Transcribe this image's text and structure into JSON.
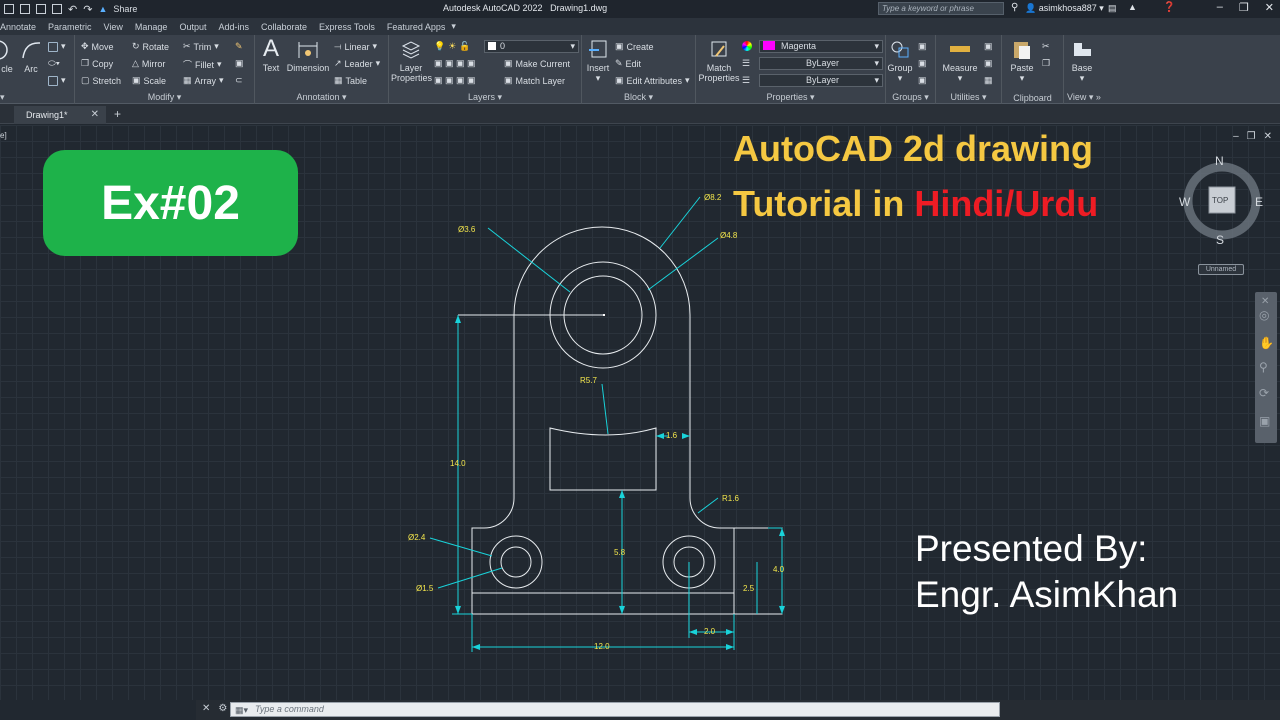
{
  "titlebar": {
    "share_label": "Share",
    "app_title": "Autodesk AutoCAD 2022",
    "file_name": "Drawing1.dwg",
    "search_placeholder": "Type a keyword or phrase",
    "username": "asimkhosa887"
  },
  "menu_tabs": [
    "Annotate",
    "Parametric",
    "View",
    "Manage",
    "Output",
    "Add-ins",
    "Collaborate",
    "Express Tools",
    "Featured Apps"
  ],
  "ribbon": {
    "draw": {
      "circle_label": "cle",
      "arc_label": "Arc"
    },
    "modify": {
      "label": "Modify",
      "move": "Move",
      "rotate": "Rotate",
      "trim": "Trim",
      "copy": "Copy",
      "mirror": "Mirror",
      "fillet": "Fillet",
      "stretch": "Stretch",
      "scale": "Scale",
      "array": "Array"
    },
    "annotation": {
      "label": "Annotation",
      "text": "Text",
      "dimension": "Dimension",
      "linear": "Linear",
      "leader": "Leader",
      "table": "Table"
    },
    "layers": {
      "label": "Layers",
      "layer_properties_l1": "Layer",
      "layer_properties_l2": "Properties",
      "current_layer": "0",
      "make_current": "Make Current",
      "match_layer": "Match Layer"
    },
    "block": {
      "label": "Block",
      "insert": "Insert",
      "create": "Create",
      "edit": "Edit",
      "edit_attributes": "Edit Attributes"
    },
    "properties": {
      "label": "Properties",
      "match_l1": "Match",
      "match_l2": "Properties",
      "color": "Magenta",
      "linetype": "ByLayer",
      "lineweight": "ByLayer"
    },
    "groups": {
      "label": "Groups",
      "group": "Group"
    },
    "utilities": {
      "label": "Utilities",
      "measure": "Measure"
    },
    "clipboard": {
      "label": "Clipboard",
      "paste": "Paste"
    },
    "view": {
      "label": "View",
      "base": "Base"
    }
  },
  "doc_tab": {
    "label": "Drawing1*"
  },
  "overlay": {
    "badge": "Ex#02",
    "title_line1": "AutoCAD 2d drawing",
    "title_line2_a": "Tutorial in ",
    "title_line2_b": "Hindi/Urdu",
    "presented_line1": "Presented By:",
    "presented_line2": "Engr. AsimKhan"
  },
  "drawing": {
    "dims": {
      "d36": "Ø3.6",
      "d82": "Ø8.2",
      "d48": "Ø4.8",
      "r57": "R5.7",
      "d16": "1.6",
      "len14": "14.0",
      "r16": "R1.6",
      "d24": "Ø2.4",
      "d15": "Ø1.5",
      "d58": "5.8",
      "d40": "4.0",
      "d25": "2.5",
      "d20": "2.0",
      "d120": "12.0"
    }
  },
  "viewcube": {
    "n": "N",
    "s": "S",
    "e": "E",
    "w": "W",
    "top": "TOP",
    "ucs": "Unnamed"
  },
  "command": {
    "placeholder": "Type a command"
  },
  "colors": {
    "dimension": "#19d3da",
    "dim_text": "#f3e64c",
    "geometry": "#e8ecef",
    "badge": "#1eb24a",
    "title_yellow": "#f5c842",
    "title_red": "#ee1c24"
  }
}
